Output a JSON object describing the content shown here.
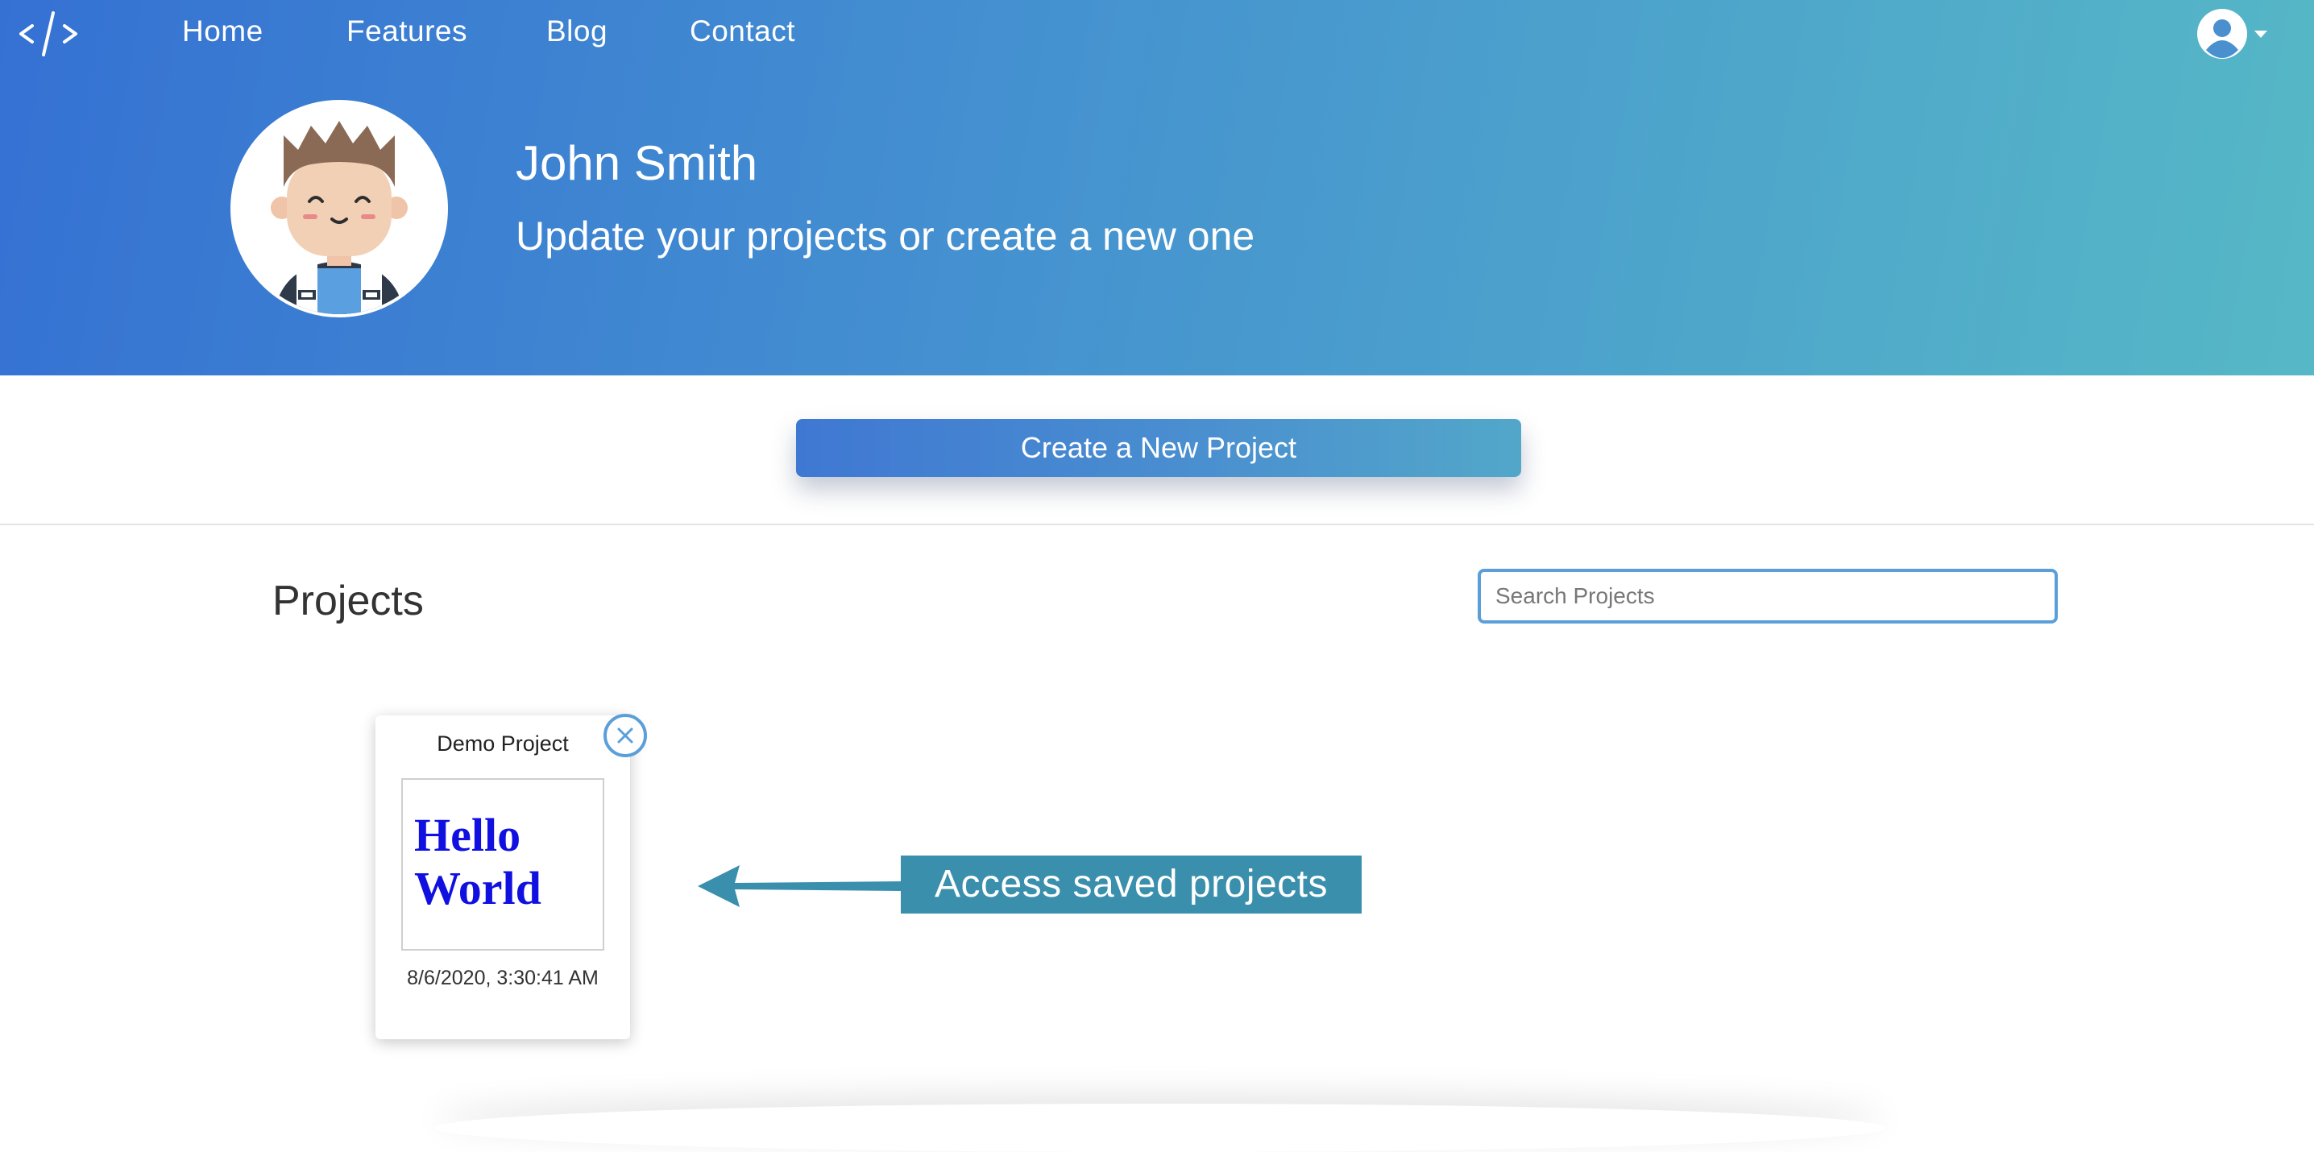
{
  "nav": {
    "links": [
      "Home",
      "Features",
      "Blog",
      "Contact"
    ],
    "logo_icon": "code-icon",
    "user_icon": "user-circle-icon"
  },
  "profile": {
    "name": "John Smith",
    "subtitle": "Update your projects or create a new one"
  },
  "actions": {
    "create_label": "Create a New Project"
  },
  "projects": {
    "title": "Projects",
    "search_placeholder": "Search Projects",
    "items": [
      {
        "title": "Demo Project",
        "preview_text": "Hello World",
        "date": "8/6/2020, 3:30:41 AM"
      }
    ]
  },
  "annotation": {
    "label": "Access saved projects"
  },
  "colors": {
    "hero_gradient_start": "#3571d3",
    "hero_gradient_end": "#56b8c6",
    "accent_blue": "#5a9fd9",
    "annotation_bg": "#3a8fad",
    "preview_text": "#1010e0"
  }
}
